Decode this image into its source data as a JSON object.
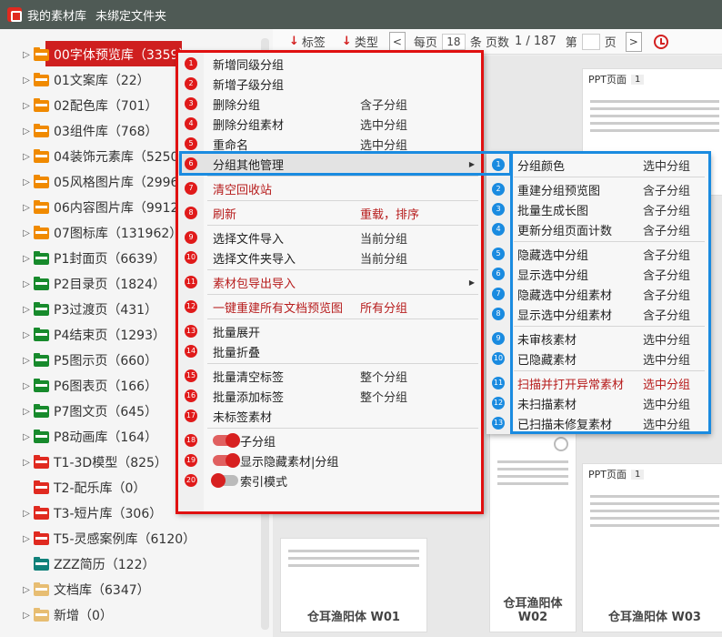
{
  "title": {
    "app": "我的素材库",
    "status": "未绑定文件夹"
  },
  "tree": [
    {
      "label": "00字体预览库（3359）",
      "color": "orange",
      "arrow": "▷",
      "selected": true
    },
    {
      "label": "01文案库（22）",
      "color": "orange",
      "arrow": "▷"
    },
    {
      "label": "02配色库（701）",
      "color": "orange",
      "arrow": "▷"
    },
    {
      "label": "03组件库（768）",
      "color": "orange",
      "arrow": "▷"
    },
    {
      "label": "04装饰元素库（5250",
      "color": "orange",
      "arrow": "▷"
    },
    {
      "label": "05风格图片库（2996",
      "color": "orange",
      "arrow": "▷"
    },
    {
      "label": "06内容图片库（9912",
      "color": "orange",
      "arrow": "▷"
    },
    {
      "label": "07图标库（131962）",
      "color": "orange",
      "arrow": "▷"
    },
    {
      "label": "P1封面页（6639）",
      "color": "green",
      "arrow": "▷"
    },
    {
      "label": "P2目录页（1824）",
      "color": "green",
      "arrow": "▷"
    },
    {
      "label": "P3过渡页（431）",
      "color": "green",
      "arrow": "▷"
    },
    {
      "label": "P4结束页（1293）",
      "color": "green",
      "arrow": "▷"
    },
    {
      "label": "P5图示页（660）",
      "color": "green",
      "arrow": "▷"
    },
    {
      "label": "P6图表页（166）",
      "color": "green",
      "arrow": "▷"
    },
    {
      "label": "P7图文页（645）",
      "color": "green",
      "arrow": "▷"
    },
    {
      "label": "P8动画库（164）",
      "color": "green",
      "arrow": "▷"
    },
    {
      "label": "T1-3D模型（825）",
      "color": "red",
      "arrow": "▷"
    },
    {
      "label": "T2-配乐库（0）",
      "color": "red",
      "arrow": ""
    },
    {
      "label": "T3-短片库（306）",
      "color": "red",
      "arrow": "▷"
    },
    {
      "label": "T5-灵感案例库（6120）",
      "color": "red",
      "arrow": "▷"
    },
    {
      "label": "ZZZ简历（122）",
      "color": "teal",
      "arrow": ""
    },
    {
      "label": "文档库（6347）",
      "color": "tan",
      "arrow": "▷"
    },
    {
      "label": "新增（0）",
      "color": "tan",
      "arrow": "▷"
    }
  ],
  "toolbar": {
    "tag_label": "标签",
    "type_label": "类型",
    "prev": "<",
    "next": ">",
    "per_page_label": "每页",
    "per_page_value": "18",
    "pages_label": "条 页数",
    "pages_value": "1 / 187",
    "goto_prefix": "第",
    "goto_suffix": "页"
  },
  "cards": [
    {
      "head": "PPT页面",
      "badge": "1",
      "name": ""
    },
    {
      "head": "",
      "badge": "",
      "name": "仓耳渔阳体 W01"
    },
    {
      "head": "",
      "badge": "",
      "name": "仓耳渔阳体 W02"
    },
    {
      "head": "PPT页面",
      "badge": "1",
      "name": "仓耳渔阳体 W03"
    }
  ],
  "menu_main": [
    {
      "num": "1",
      "label": "新增同级分组",
      "sub": ""
    },
    {
      "num": "2",
      "label": "新增子级分组",
      "sub": ""
    },
    {
      "num": "3",
      "label": "删除分组",
      "sub": "含子分组"
    },
    {
      "num": "4",
      "label": "删除分组素材",
      "sub": "选中分组"
    },
    {
      "num": "5",
      "label": "重命名",
      "sub": "选中分组"
    },
    {
      "num": "6",
      "label": "分组其他管理",
      "sub": "",
      "chevron": "▶",
      "highlight": true
    },
    {
      "num": "7",
      "label": "清空回收站",
      "sub": "",
      "danger": true
    },
    {
      "num": "8",
      "label": "刷新",
      "sub": "重载，排序",
      "danger": true
    },
    {
      "num": "9",
      "label": "选择文件导入",
      "sub": "当前分组"
    },
    {
      "num": "10",
      "label": "选择文件夹导入",
      "sub": "当前分组"
    },
    {
      "num": "11",
      "label": "素材包导出导入",
      "sub": "",
      "chevron": "▶",
      "danger": true
    },
    {
      "num": "12",
      "label": "一键重建所有文档预览图",
      "sub": "所有分组",
      "danger": true
    },
    {
      "num": "13",
      "label": "批量展开",
      "sub": ""
    },
    {
      "num": "14",
      "label": "批量折叠",
      "sub": ""
    },
    {
      "num": "15",
      "label": "批量清空标签",
      "sub": "整个分组"
    },
    {
      "num": "16",
      "label": "批量添加标签",
      "sub": "整个分组"
    },
    {
      "num": "17",
      "label": "未标签素材",
      "sub": ""
    },
    {
      "num": "18",
      "label": "子分组",
      "sub": "",
      "toggle": "on"
    },
    {
      "num": "19",
      "label": "显示隐藏素材|分组",
      "sub": "",
      "toggle": "on"
    },
    {
      "num": "20",
      "label": "索引模式",
      "sub": "",
      "toggle": "off"
    }
  ],
  "menu_sub": [
    {
      "num": "1",
      "label": "分组颜色",
      "sub": "选中分组"
    },
    {
      "num": "2",
      "label": "重建分组预览图",
      "sub": "含子分组"
    },
    {
      "num": "3",
      "label": "批量生成长图",
      "sub": "含子分组"
    },
    {
      "num": "4",
      "label": "更新分组页面计数",
      "sub": "含子分组"
    },
    {
      "num": "5",
      "label": "隐藏选中分组",
      "sub": "含子分组"
    },
    {
      "num": "6",
      "label": "显示选中分组",
      "sub": "含子分组"
    },
    {
      "num": "7",
      "label": "隐藏选中分组素材",
      "sub": "含子分组"
    },
    {
      "num": "8",
      "label": "显示选中分组素材",
      "sub": "含子分组"
    },
    {
      "num": "9",
      "label": "未审核素材",
      "sub": "选中分组"
    },
    {
      "num": "10",
      "label": "已隐藏素材",
      "sub": "选中分组"
    },
    {
      "num": "11",
      "label": "扫描并打开异常素材",
      "sub": "选中分组",
      "danger": true
    },
    {
      "num": "12",
      "label": "未扫描素材",
      "sub": "选中分组"
    },
    {
      "num": "13",
      "label": "已扫描未修复素材",
      "sub": "选中分组"
    }
  ],
  "colors": {
    "accent_red": "#e01010",
    "accent_blue": "#1a8be0",
    "titlebar": "#4f5a55"
  }
}
